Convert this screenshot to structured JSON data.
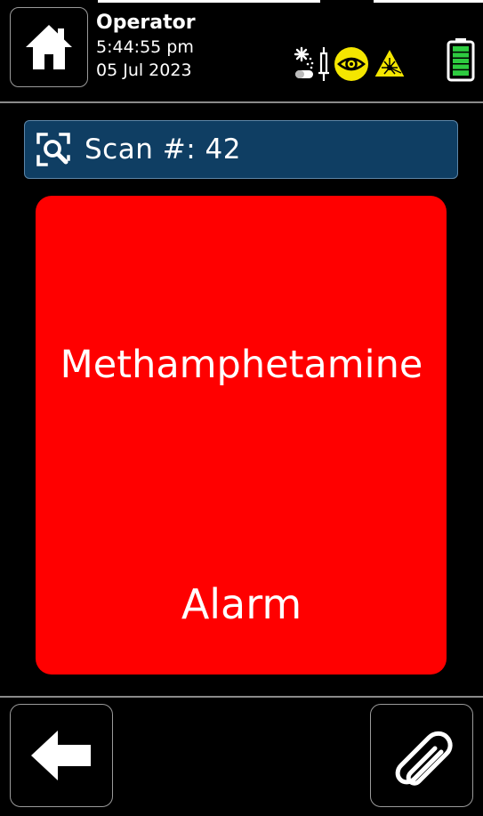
{
  "header": {
    "user": "Operator",
    "time": "5:44:55 pm",
    "date": "05 Jul 2023",
    "status_icons": [
      "chemical-sample-icon",
      "eye-safety-icon",
      "laser-warning-icon"
    ],
    "battery_level": 1.0
  },
  "scan": {
    "label": "Scan #: 42"
  },
  "result": {
    "substance": "Methamphetamine",
    "status": "Alarm",
    "color": "#ff0000"
  },
  "footer": {
    "back_icon": "arrow-left-icon",
    "attach_icon": "paperclip-icon"
  },
  "colors": {
    "background": "#000000",
    "scan_bar": "#0f3e63",
    "alarm": "#ff0000",
    "warning": "#f4e600",
    "battery": "#2ecc40"
  }
}
